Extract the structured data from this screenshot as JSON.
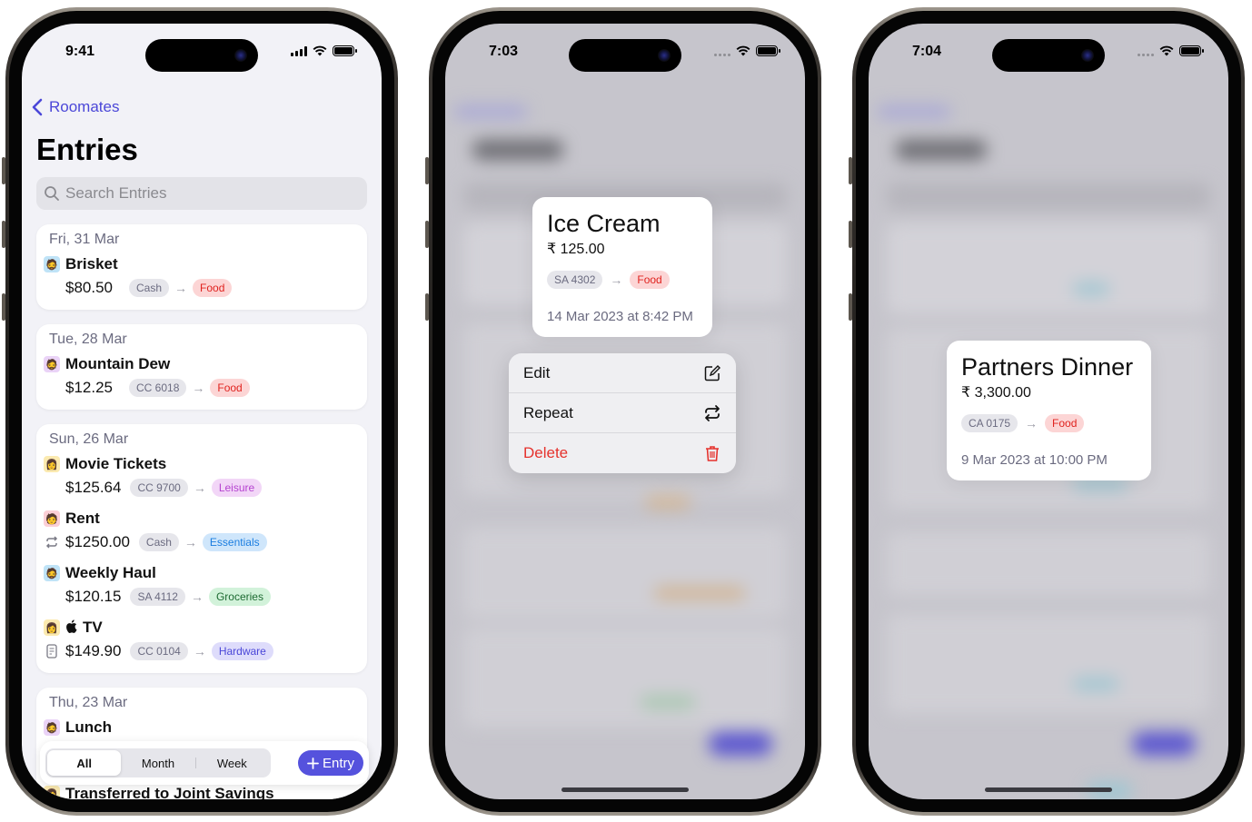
{
  "phone1": {
    "status": {
      "time": "9:41"
    },
    "back_label": "Roomates",
    "title": "Entries",
    "search_placeholder": "Search Entries",
    "groups": [
      {
        "date": "Fri, 31 Mar",
        "entries": [
          {
            "title": "Brisket",
            "avatar": "memoji-blue",
            "lead_icon": "",
            "amount": "$80.50",
            "source": "Cash",
            "category": "Food"
          }
        ]
      },
      {
        "date": "Tue, 28 Mar",
        "entries": [
          {
            "title": "Mountain Dew",
            "avatar": "memoji-purple",
            "lead_icon": "",
            "amount": "$12.25",
            "source": "CC 6018",
            "category": "Food"
          }
        ]
      },
      {
        "date": "Sun, 26 Mar",
        "entries": [
          {
            "title": "Movie Tickets",
            "avatar": "memoji-yellow",
            "lead_icon": "",
            "amount": "$125.64",
            "source": "CC 9700",
            "category": "Leisure"
          },
          {
            "title": "Rent",
            "avatar": "memoji-pink",
            "lead_icon": "repeat-icon",
            "amount": "$1250.00",
            "source": "Cash",
            "category": "Essentials"
          },
          {
            "title": "Weekly Haul",
            "avatar": "memoji-blue",
            "lead_icon": "",
            "amount": "$120.15",
            "source": "SA 4112",
            "category": "Groceries"
          },
          {
            "title": "TV",
            "avatar": "memoji-yellow",
            "brand_icon": "apple-icon",
            "lead_icon": "receipt-icon",
            "amount": "$149.90",
            "source": "CC 0104",
            "category": "Hardware"
          }
        ]
      },
      {
        "date": "Thu, 23 Mar",
        "entries": [
          {
            "title": "Lunch",
            "avatar": "memoji-purple"
          }
        ]
      }
    ],
    "peek_entry": "Transferred to Joint Savings",
    "filter": {
      "options": [
        "All",
        "Month",
        "Week"
      ],
      "selected": "All"
    },
    "add_button": "Entry"
  },
  "phone2": {
    "status": {
      "time": "7:03"
    },
    "preview": {
      "title": "Ice Cream",
      "amount": "₹ 125.00",
      "source": "SA 4302",
      "category": "Food",
      "datetime": "14 Mar 2023 at 8:42 PM"
    },
    "menu": [
      {
        "label": "Edit",
        "icon": "edit-icon"
      },
      {
        "label": "Repeat",
        "icon": "repeat-icon"
      },
      {
        "label": "Delete",
        "icon": "trash-icon",
        "destructive": true
      }
    ]
  },
  "phone3": {
    "status": {
      "time": "7:04"
    },
    "preview": {
      "title": "Partners Dinner",
      "amount": "₹ 3,300.00",
      "source": "CA 0175",
      "category": "Food",
      "datetime": "9 Mar 2023 at 10:00 PM"
    }
  },
  "colors": {
    "accent": "#5552dd",
    "food": "#e0231f",
    "leisure": "#b543d0",
    "essentials": "#1a7de0",
    "groceries": "#1d6a32",
    "hardware": "#4b47d8",
    "destructive": "#e5322d"
  }
}
